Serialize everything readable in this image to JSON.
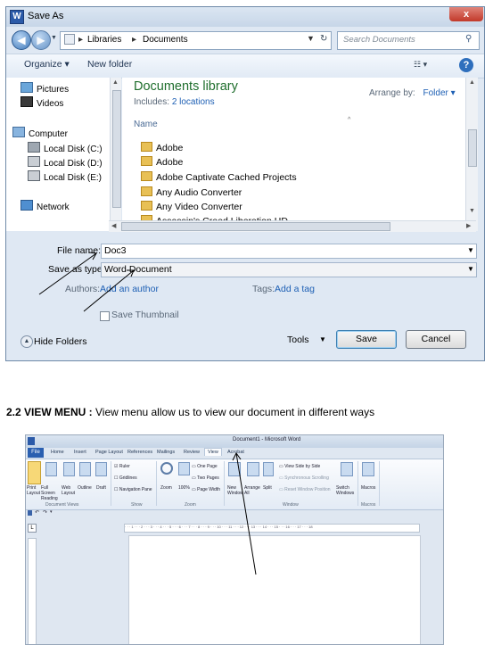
{
  "dialog": {
    "title": "Save As",
    "close": "x",
    "breadcrumb": [
      "Libraries",
      "Documents"
    ],
    "search_placeholder": "Search Documents",
    "toolbar": {
      "organize": "Organize ▾",
      "new_folder": "New folder"
    },
    "nav": [
      "Pictures",
      "Videos",
      "Computer",
      "Local Disk (C:)",
      "Local Disk (D:)",
      "Local Disk (E:)",
      "Network"
    ],
    "library": {
      "title": "Documents library",
      "includes_label": "Includes:",
      "includes_link": "2 locations",
      "arrange_label": "Arrange by:",
      "arrange_value": "Folder ▾",
      "column": "Name",
      "files": [
        "Adobe",
        "Adobe",
        "Adobe Captivate Cached Projects",
        "Any Audio Converter",
        "Any Video Converter",
        "Assassin's Creed Liberation HD"
      ]
    },
    "fields": {
      "file_name_label": "File name:",
      "file_name_value": "Doc3",
      "save_type_label": "Save as type:",
      "save_type_value": "Word Document",
      "authors_label": "Authors:",
      "authors_link": "Add an author",
      "tags_label": "Tags:",
      "tags_link": "Add a tag",
      "thumbnail_label": "Save Thumbnail"
    },
    "footer": {
      "hide_folders": "Hide Folders",
      "tools": "Tools",
      "save": "Save",
      "cancel": "Cancel"
    }
  },
  "heading": {
    "bold": "2.2 VIEW MENU :",
    "text": " View menu allow us to view our document in different ways"
  },
  "word": {
    "title": "Document1 - Microsoft Word",
    "tabs": [
      "File",
      "Home",
      "Insert",
      "Page Layout",
      "References",
      "Mailings",
      "Review",
      "View",
      "Acrobat"
    ],
    "views": [
      "Print Layout",
      "Full Screen Reading",
      "Web Layout",
      "Outline",
      "Draft"
    ],
    "group_views": "Document Views",
    "show": [
      "Ruler",
      "Gridlines",
      "Navigation Pane"
    ],
    "group_show": "Show",
    "zoom": [
      "Zoom",
      "100%",
      "One Page",
      "Two Pages",
      "Page Width"
    ],
    "group_zoom": "Zoom",
    "window": [
      "New Window",
      "Arrange All",
      "Split",
      "View Side by Side",
      "Synchronous Scrolling",
      "Reset Window Position",
      "Switch Windows"
    ],
    "group_window": "Window",
    "macros": "Macros",
    "group_macros": "Macros",
    "ruler_text": "· · · 1 · · · 2 · · · 3 · · · 4 · · · 5 · · · 6 · · · 7 · · · 8 · · · 9 · · · 10 · · · 11 · · · 12 · · · 13 · · · 14 · · · 15 · · · 16 · · · 17 · · · 18"
  }
}
